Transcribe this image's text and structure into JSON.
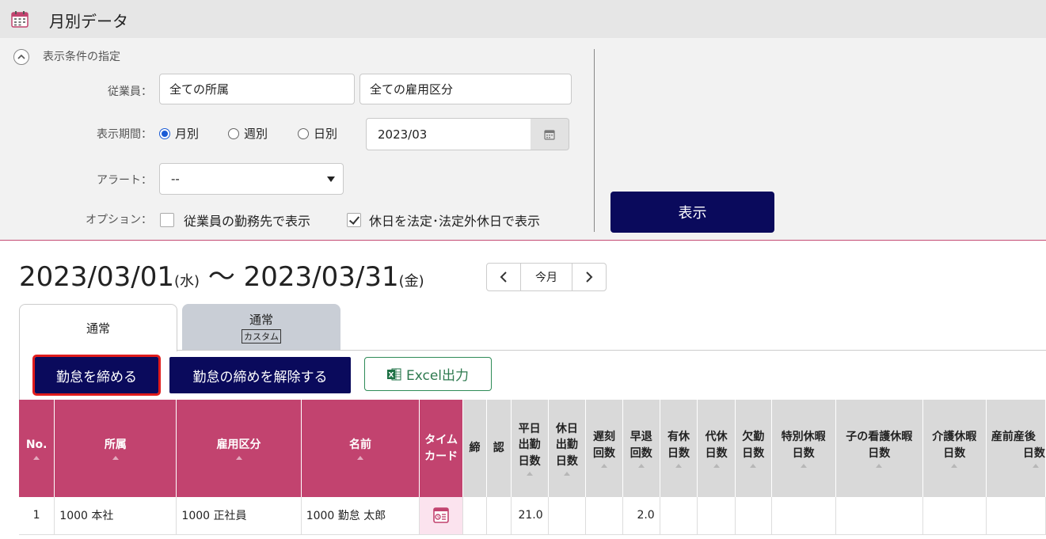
{
  "header": {
    "title": "月別データ",
    "icon": "calendar-icon",
    "icon_color": "#c2436f"
  },
  "filter": {
    "section_title": "表示条件の指定",
    "employee_label": "従業員：",
    "dept_value": "全ての所属",
    "employment_value": "全ての雇用区分",
    "period_label": "表示期間：",
    "period_options": [
      {
        "label": "月別",
        "selected": true
      },
      {
        "label": "週別",
        "selected": false
      },
      {
        "label": "日別",
        "selected": false
      }
    ],
    "month_value": "2023/03",
    "alert_label": "アラート：",
    "alert_value": "--",
    "option_label": "オプション：",
    "options": [
      {
        "label": "従業員の勤務先で表示",
        "checked": false
      },
      {
        "label": "休日を法定･法定外休日で表示",
        "checked": true
      }
    ],
    "show_button": "表示"
  },
  "range": {
    "start": "2023/03/01",
    "start_dow": "(水)",
    "sep": "〜",
    "end": "2023/03/31",
    "end_dow": "(金)"
  },
  "nav": {
    "current_label": "今月"
  },
  "tabs": [
    {
      "label": "通常",
      "badge": ""
    },
    {
      "label": "通常",
      "badge": "カスタム"
    }
  ],
  "actions": {
    "close_label": "勤怠を締める",
    "release_label": "勤怠の締めを解除する",
    "excel_label": "Excel出力"
  },
  "colors": {
    "brand_pink": "#c2436f",
    "navy": "#0a0a5c",
    "excel_green": "#2e8b57",
    "highlight_red": "#e01c1c"
  },
  "table": {
    "headers": {
      "no": "No.",
      "dept": "所属",
      "employment": "雇用区分",
      "name": "名前",
      "timecard_1": "タイム",
      "timecard_2": "カード",
      "close": "締",
      "approve": "認",
      "weekday_1": "平日",
      "weekday_2": "出勤",
      "weekday_3": "日数",
      "holiday_1": "休日",
      "holiday_2": "出勤",
      "holiday_3": "日数",
      "late_1": "遅刻",
      "late_2": "回数",
      "early_1": "早退",
      "early_2": "回数",
      "paid_1": "有休",
      "paid_2": "日数",
      "comp_1": "代休",
      "comp_2": "日数",
      "absence_1": "欠勤",
      "absence_2": "日数",
      "special_1": "特別休暇",
      "special_2": "日数",
      "childcare_1": "子の看護休暇",
      "childcare_2": "日数",
      "nursing_1": "介護休暇",
      "nursing_2": "日数",
      "maternity_1": "産前産後",
      "maternity_2": "日数"
    },
    "rows": [
      {
        "no": "1",
        "dept": "1000 本社",
        "employment": "1000 正社員",
        "name": "1000 勤怠 太郎",
        "weekday": "21.0",
        "late": "",
        "early": "2.0"
      }
    ]
  }
}
